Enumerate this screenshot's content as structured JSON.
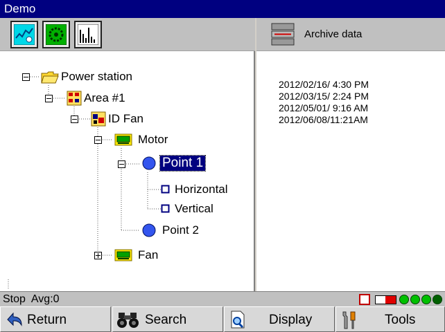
{
  "window": {
    "title": "Demo"
  },
  "tree": {
    "nodes": [
      {
        "label": "Power station",
        "icon": "folder-icon"
      },
      {
        "label": "Area #1",
        "icon": "area-icon"
      },
      {
        "label": "ID Fan",
        "icon": "machine-icon"
      },
      {
        "label": "Motor",
        "icon": "component-icon"
      },
      {
        "label": "Point 1",
        "icon": "point-icon",
        "selected": true
      },
      {
        "label": "Horizontal",
        "icon": "direction-icon"
      },
      {
        "label": "Vertical",
        "icon": "direction-icon"
      },
      {
        "label": "Point 2",
        "icon": "point-icon"
      },
      {
        "label": "Fan",
        "icon": "component-icon"
      }
    ]
  },
  "archive": {
    "title": "Archive data",
    "items": [
      "2012/02/16/ 4:30 PM",
      "2012/03/15/ 2:24 PM",
      "2012/05/01/ 9:16 AM",
      "2012/06/08/11:21AM"
    ]
  },
  "status": {
    "state": "Stop",
    "avg": "Avg:0"
  },
  "buttons": {
    "return": "Return",
    "search": "Search",
    "display": "Display",
    "tools": "Tools"
  },
  "colors": {
    "title_bar": "#000080",
    "selection": "#000080",
    "led_on": "#00c000",
    "point": "#3355ee"
  }
}
